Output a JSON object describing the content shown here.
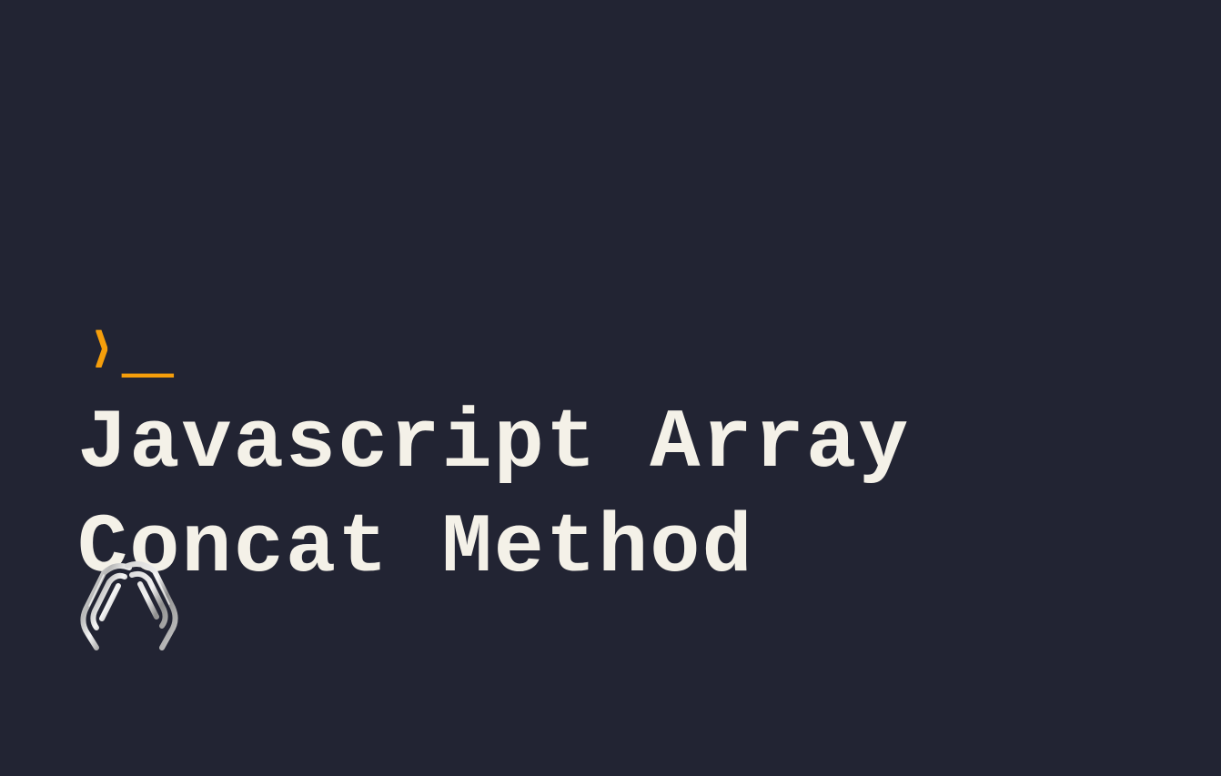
{
  "prompt": {
    "chevron": "›",
    "underscore": "_"
  },
  "title": {
    "text": "Javascript Array Concat Method"
  },
  "colors": {
    "background": "#222433",
    "accent": "#F59E0B",
    "text": "#F4F1E8"
  },
  "logo": {
    "name": "paperclip-a-logo"
  }
}
